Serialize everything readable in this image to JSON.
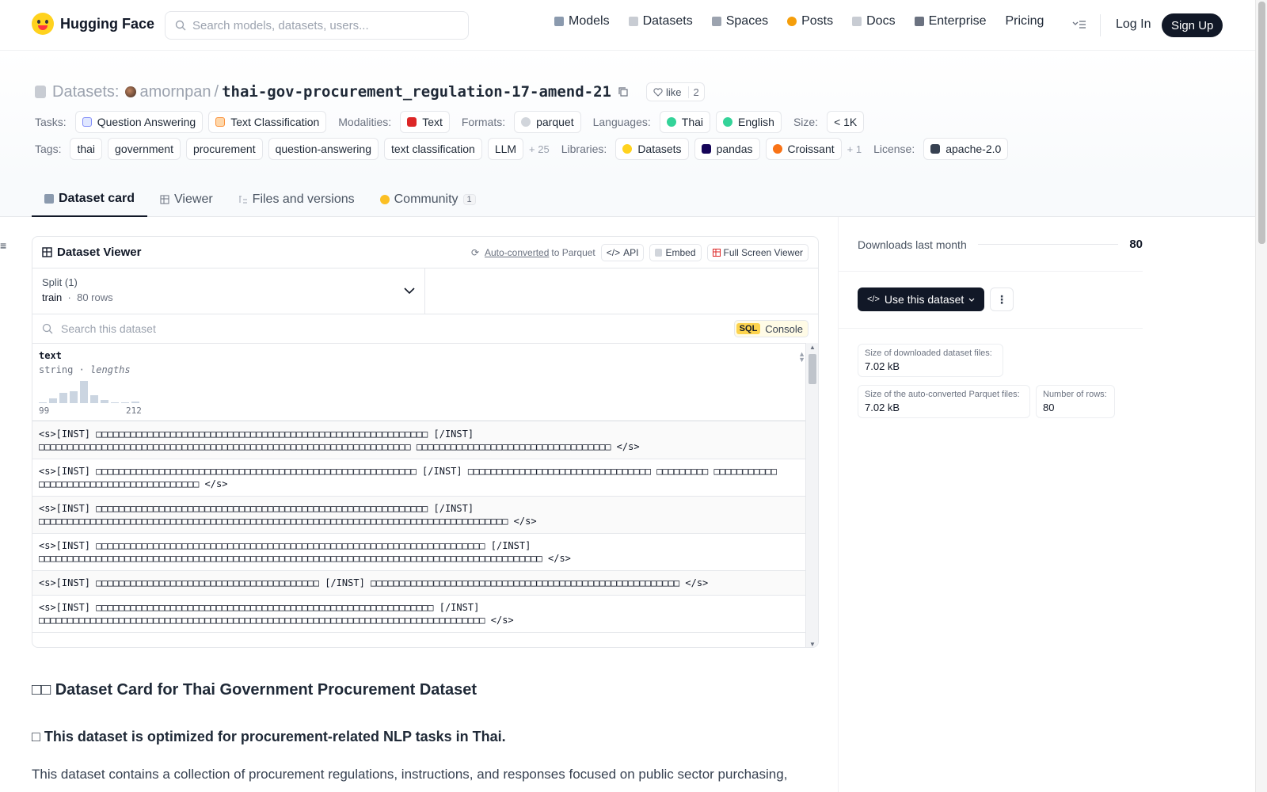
{
  "brand": {
    "name": "Hugging Face"
  },
  "search": {
    "placeholder": "Search models, datasets, users..."
  },
  "nav": {
    "items": [
      {
        "label": "Models",
        "color": "#8b9aae"
      },
      {
        "label": "Datasets",
        "color": "#c8ccd3"
      },
      {
        "label": "Spaces",
        "color": "#9ca3af"
      },
      {
        "label": "Posts",
        "color": "#f59e0b"
      },
      {
        "label": "Docs",
        "color": "#c8ccd3"
      },
      {
        "label": "Enterprise",
        "color": "#6b7280"
      },
      {
        "label": "Pricing"
      }
    ],
    "login": "Log In",
    "signup": "Sign Up"
  },
  "repo": {
    "kind_label": "Datasets:",
    "owner": "amornpan",
    "slash": "/",
    "name": "thai-gov-procurement_regulation-17-amend-21",
    "like_label": "like",
    "like_count": "2"
  },
  "meta_row1": {
    "tasks_label": "Tasks:",
    "tasks": [
      "Question Answering",
      "Text Classification"
    ],
    "modalities_label": "Modalities:",
    "modalities": [
      "Text"
    ],
    "formats_label": "Formats:",
    "formats": [
      "parquet"
    ],
    "languages_label": "Languages:",
    "languages": [
      "Thai",
      "English"
    ],
    "size_label": "Size:",
    "size": "< 1K"
  },
  "meta_row2": {
    "tags_label": "Tags:",
    "tags": [
      "thai",
      "government",
      "procurement",
      "question-answering",
      "text classification",
      "LLM"
    ],
    "tags_more": "+ 25",
    "libraries_label": "Libraries:",
    "libraries": [
      "Datasets",
      "pandas",
      "Croissant"
    ],
    "libraries_more": "+ 1",
    "license_label": "License:",
    "license": "apache-2.0"
  },
  "tabs": [
    {
      "label": "Dataset card",
      "active": true
    },
    {
      "label": "Viewer"
    },
    {
      "label": "Files and versions"
    },
    {
      "label": "Community",
      "count": "1"
    }
  ],
  "viewer": {
    "title": "Dataset Viewer",
    "auto_converted": "Auto-converted",
    "to_parquet": "to Parquet",
    "api": "API",
    "embed": "Embed",
    "fullscreen": "Full Screen Viewer",
    "split_label": "Split (1)",
    "split_name": "train",
    "split_rows": "80 rows",
    "search_placeholder": "Search this dataset",
    "sql_tag": "SQL",
    "sql_label": "Console",
    "column": {
      "name": "text",
      "type": "string",
      "stat": "lengths",
      "min": "99",
      "max": "212",
      "histogram": [
        0.05,
        0.2,
        0.45,
        0.55,
        1.0,
        0.35,
        0.15,
        0.05,
        0.0,
        0.08
      ]
    },
    "rows": [
      "<s>[INST] □□□□□□□□□□□□□□□□□□□□□□□□□□□□□□□□□□□□□□□□□□□□□□□□□□□□□□□□□□ [/INST] □□□□□□□□□□□□□□□□□□□□□□□□□□□□□□□□□□□□□□□□□□□□□□□□□□□□□□□□□□□□□□□□□ □□□□□□□□□□□□□□□□□□□□□□□□□□□□□□□□□□ </s>",
      "<s>[INST] □□□□□□□□□□□□□□□□□□□□□□□□□□□□□□□□□□□□□□□□□□□□□□□□□□□□□□□□ [/INST] □□□□□□□□□□□□□□□□□□□□□□□□□□□□□□□□ □□□□□□□□□ □□□□□□□□□□□ □□□□□□□□□□□□□□□□□□□□□□□□□□□□ </s>",
      "<s>[INST] □□□□□□□□□□□□□□□□□□□□□□□□□□□□□□□□□□□□□□□□□□□□□□□□□□□□□□□□□□ [/INST] □□□□□□□□□□□□□□□□□□□□□□□□□□□□□□□□□□□□□□□□□□□□□□□□□□□□□□□□□□□□□□□□□□□□□□□□□□□□□□□□□□ </s>",
      "<s>[INST] □□□□□□□□□□□□□□□□□□□□□□□□□□□□□□□□□□□□□□□□□□□□□□□□□□□□□□□□□□□□□□□□□□□□ [/INST] □□□□□□□□□□□□□□□□□□□□□□□□□□□□□□□□□□□□□□□□□□□□□□□□□□□□□□□□□□□□□□□□□□□□□□□□□□□□□□□□□□□□□□□□ </s>",
      "<s>[INST] □□□□□□□□□□□□□□□□□□□□□□□□□□□□□□□□□□□□□□□ [/INST] □□□□□□□□□□□□□□□□□□□□□□□□□□□□□□□□□□□□□□□□□□□□□□□□□□□□□□ </s>",
      "<s>[INST] □□□□□□□□□□□□□□□□□□□□□□□□□□□□□□□□□□□□□□□□□□□□□□□□□□□□□□□□□□□ [/INST] □□□□□□□□□□□□□□□□□□□□□□□□□□□□□□□□□□□□□□□□□□□□□□□□□□□□□□□□□□□□□□□□□□□□□□□□□□□□□□ </s>"
    ]
  },
  "sidebar": {
    "downloads_label": "Downloads last month",
    "downloads": "80",
    "use_button": "Use this dataset",
    "size_dl_label": "Size of downloaded dataset files:",
    "size_dl": "7.02 kB",
    "size_pq_label": "Size of the auto-converted Parquet files:",
    "size_pq": "7.02 kB",
    "rows_label": "Number of rows:",
    "rows": "80"
  },
  "card": {
    "h1": "□□ Dataset Card for Thai Government Procurement Dataset",
    "h2": "□ This dataset is optimized for procurement-related NLP tasks in Thai.",
    "p1": "This dataset contains a collection of procurement regulations, instructions, and responses focused on public sector purchasing,"
  }
}
